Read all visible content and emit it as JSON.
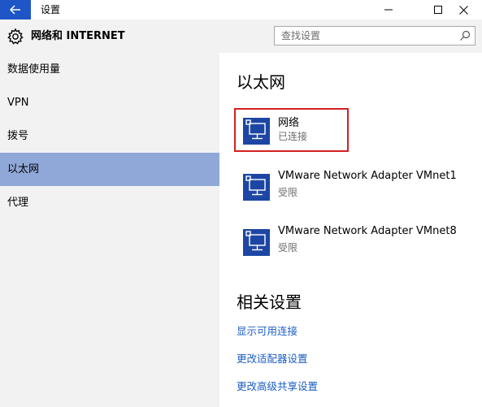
{
  "window": {
    "title": "设置",
    "controls": {
      "minimize": "minimize-icon",
      "maximize": "maximize-icon",
      "close": "close-icon"
    },
    "accent_color": "#1e56c8"
  },
  "header": {
    "title": "网络和 INTERNET",
    "search_placeholder": "查找设置"
  },
  "sidebar": {
    "items": [
      {
        "label": "数据使用量",
        "selected": false
      },
      {
        "label": "VPN",
        "selected": false
      },
      {
        "label": "拨号",
        "selected": false
      },
      {
        "label": "以太网",
        "selected": true
      },
      {
        "label": "代理",
        "selected": false
      }
    ],
    "selected_color": "#90a8d8"
  },
  "main": {
    "section_title": "以太网",
    "adapters": [
      {
        "name": "网络",
        "status": "已连接",
        "highlighted": true
      },
      {
        "name": "VMware Network Adapter VMnet1",
        "status": "受限",
        "highlighted": false
      },
      {
        "name": "VMware Network Adapter VMnet8",
        "status": "受限",
        "highlighted": false
      }
    ],
    "related_title": "相关设置",
    "related_links": [
      "显示可用连接",
      "更改适配器设置",
      "更改高级共享设置"
    ],
    "link_color": "#1a5cc4",
    "highlight_color": "#d42020"
  }
}
